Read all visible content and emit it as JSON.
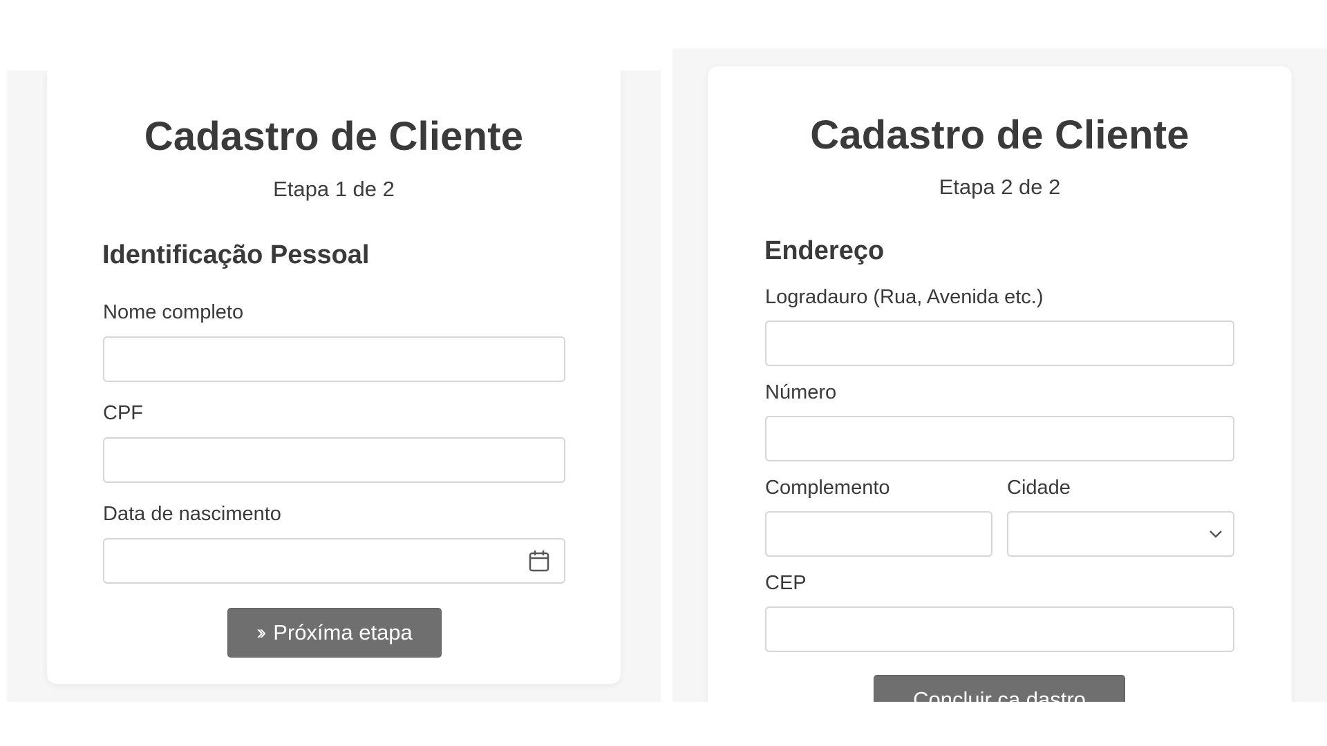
{
  "step1": {
    "title": "Cadastro de Cliente",
    "step": "Etapa 1 de 2",
    "section": "Identificação Pessoal",
    "fields": {
      "nome": {
        "label": "Nome completo",
        "value": "",
        "placeholder": ""
      },
      "cpf": {
        "label": "CPF",
        "value": "",
        "placeholder": ""
      },
      "nascimento": {
        "label": "Data de nascimento",
        "value": "",
        "placeholder": ""
      }
    },
    "icons": {
      "calendar": "calendar-icon",
      "next": "double-chevron-right-icon"
    },
    "next_button": {
      "icon": "››",
      "label": "Próxíma etapa"
    }
  },
  "step2": {
    "title": "Cadastro de Cliente",
    "step": "Etapa 2 de 2",
    "section": "Endereço",
    "fields": {
      "logradouro": {
        "label": "Logradauro (Rua, Avenida etc.)",
        "value": "",
        "placeholder": ""
      },
      "numero": {
        "label": "Número",
        "value": "",
        "placeholder": ""
      },
      "complemento": {
        "label": "Complemento",
        "value": "",
        "placeholder": ""
      },
      "cidade": {
        "label": "Cidade",
        "selected": ""
      },
      "cep": {
        "label": "CEP",
        "value": "",
        "placeholder": ""
      }
    },
    "icons": {
      "dropdown": "chevron-down-icon"
    },
    "submit_button": {
      "label": "Concluir ca dastro"
    }
  },
  "colors": {
    "page_bg": "#ffffff",
    "panel_bg": "#f6f6f6",
    "card_bg": "#ffffff",
    "button_bg": "#6f6f6f",
    "field_border": "#d6d6d6",
    "text": "#3a3a3a"
  }
}
